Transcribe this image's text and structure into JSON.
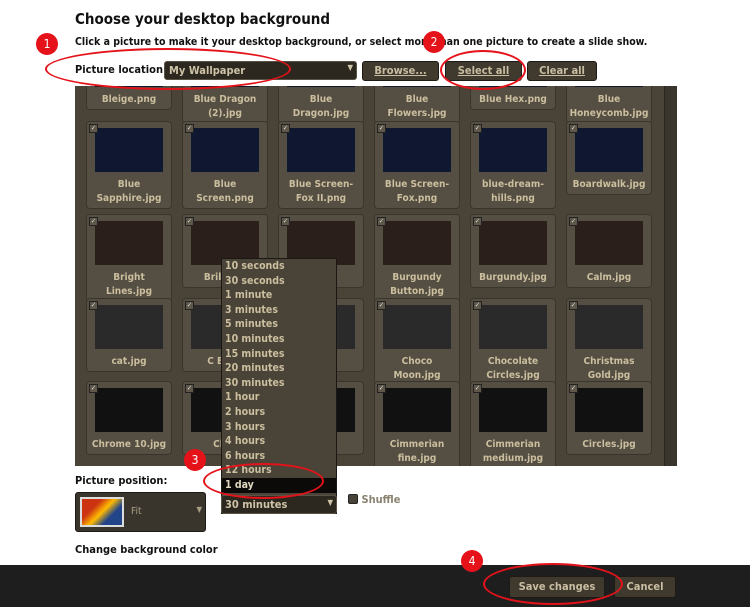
{
  "header": {
    "title": "Choose your desktop background",
    "subtitle": "Click a picture to make it your desktop background, or select more than one picture to create a slide show."
  },
  "location": {
    "label": "Picture location:",
    "value": "My Wallpaper",
    "browse": "Browse...",
    "select_all": "Select all",
    "clear_all": "Clear all"
  },
  "tiles": [
    [
      "Bleige.png",
      "Blue Dragon (2).jpg",
      "Blue Dragon.jpg",
      "Blue Flowers.jpg",
      "Blue Hex.png",
      "Blue Honeycomb.jpg"
    ],
    [
      "Blue Sapphire.jpg",
      "Blue Screen.png",
      "Blue Screen-Fox II.png",
      "Blue Screen-Fox.png",
      "blue-dream-hills.png",
      "Boardwalk.jpg"
    ],
    [
      "Bright Lines.jpg",
      "Brillian j",
      "g",
      "Burgundy Button.jpg",
      "Burgundy.jpg",
      "Calm.jpg"
    ],
    [
      "cat.jpg",
      "C Brow",
      "g",
      "Choco Moon.jpg",
      "Chocolate Circles.jpg",
      "Christmas Gold.jpg"
    ],
    [
      "Chrome 10.jpg",
      "Chro",
      "n g",
      "Cimmerian fine.jpg",
      "Cimmerian medium.jpg",
      "Circles.jpg"
    ]
  ],
  "interval": {
    "options": [
      "10 seconds",
      "30 seconds",
      "1 minute",
      "3 minutes",
      "5 minutes",
      "10 minutes",
      "15 minutes",
      "20 minutes",
      "30 minutes",
      "1 hour",
      "2 hours",
      "3 hours",
      "4 hours",
      "6 hours",
      "12 hours",
      "1 day"
    ],
    "highlighted": "1 day",
    "value": "30 minutes"
  },
  "position": {
    "label": "Picture position:",
    "value": "Fit"
  },
  "shuffle": {
    "label": "Shuffle",
    "checked": false
  },
  "bgcolor": {
    "label": "Change background color"
  },
  "footer": {
    "save": "Save changes",
    "cancel": "Cancel"
  },
  "annotations": [
    "1",
    "2",
    "3",
    "4"
  ],
  "colors": {
    "panel": "#4a4438",
    "annotation": "#e5121a",
    "footer": "#1e1e1e"
  }
}
